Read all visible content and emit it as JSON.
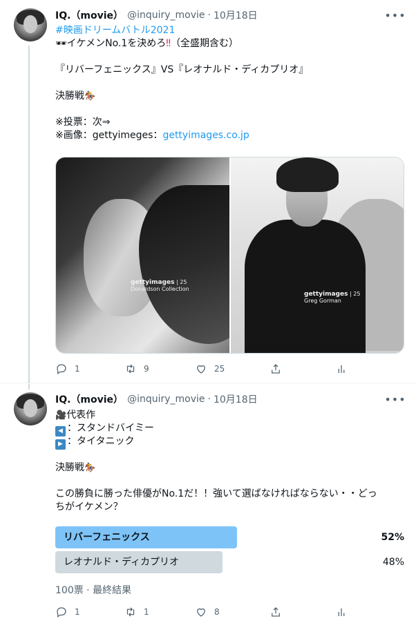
{
  "colors": {
    "link": "#1d9bf0",
    "poll_winner": "#7ec3f7",
    "poll_other": "#cfd9de",
    "muted": "#536471"
  },
  "tweet1": {
    "name": "IQ.（movie）",
    "handle": "@inquiry_movie",
    "date": "10月18日",
    "hashtag": "#映画ドリームバトル2021",
    "line_title_emoji": "🕶",
    "line_title_text": "イケメンNo.1を決めろ",
    "line_title_mark": "‼",
    "line_title_tail": "（全盛期含む）",
    "matchup": "『リバーフェニックス』VS『レオナルド・ディカプリオ』",
    "final_text": "決勝戦",
    "final_emoji": "🏇",
    "vote_note": "※投票：次⇒",
    "image_note_prefix": "※画像：gettyimeges：",
    "image_note_link": "gettyimages.co.jp",
    "media": [
      {
        "watermark": "gettyimages",
        "badge": "25",
        "credit": "Donaldson Collection"
      },
      {
        "watermark": "gettyimages",
        "badge": "25",
        "credit": "Greg Gorman"
      }
    ],
    "actions": {
      "replies": "1",
      "retweets": "9",
      "likes": "25"
    }
  },
  "tweet2": {
    "name": "IQ.（movie）",
    "handle": "@inquiry_movie",
    "date": "10月18日",
    "works_emoji": "🎥",
    "works_label": "代表作",
    "item1_icon": "◀",
    "item1_text": "：スタンドバイミー",
    "item2_icon": "▶",
    "item2_text": "：タイタニック",
    "final_text": "決勝戦",
    "final_emoji": "🏇",
    "question_line1": "この勝負に勝った俳優がNo.1だ！！強いて選ばなければならない・・どっ",
    "question_line2": "ちがイケメン？",
    "poll": {
      "options": [
        {
          "label": "リバーフェニックス",
          "percent": "52%",
          "share": 0.52,
          "winner": true
        },
        {
          "label": "レオナルド・ディカプリオ",
          "percent": "48%",
          "share": 0.48,
          "winner": false
        }
      ],
      "meta": "100票 · 最終結果"
    },
    "actions": {
      "replies": "1",
      "retweets": "1",
      "likes": "8"
    }
  }
}
